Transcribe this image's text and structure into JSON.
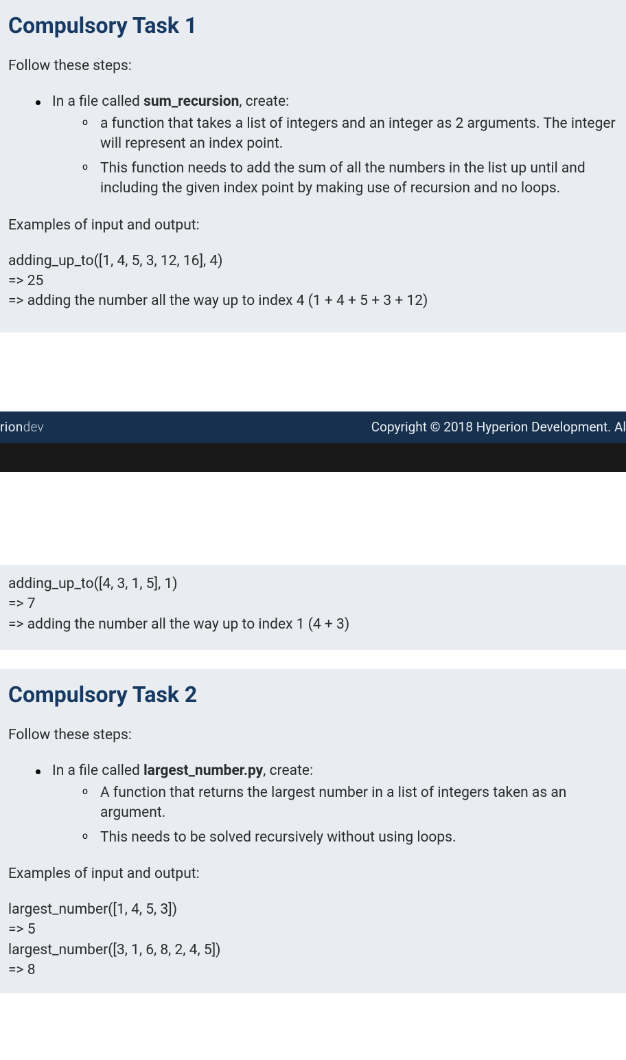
{
  "task1": {
    "title": "Compulsory Task 1",
    "follow": "Follow these steps:",
    "bullet_prefix": "In a file called ",
    "filename": "sum_recursion",
    "bullet_suffix": ", create:",
    "sub1": "a function that takes a list of integers and an integer as 2 arguments. The integer will represent an index point.",
    "sub2": "This function needs to add the sum of all the numbers in the list up until and including the given index point by making use of recursion and no loops.",
    "examples_label": "Examples of input and output:",
    "ex1_line1": "adding_up_to([1, 4, 5, 3, 12, 16], 4)",
    "ex1_line2": "=> 25",
    "ex1_line3": "=> adding the number all the way up to index 4 (1 + 4 + 5 + 3 + 12)",
    "ex2_line1": "adding_up_to([4, 3, 1, 5], 1)",
    "ex2_line2": "=> 7",
    "ex2_line3": "=> adding the number all the way up to index 1 (4 + 3)"
  },
  "footer": {
    "brand_left": "rion",
    "brand_right": "dev",
    "copyright": "Copyright © 2018 Hyperion Development. Al"
  },
  "task2": {
    "title": "Compulsory Task 2",
    "follow": "Follow these steps:",
    "bullet_prefix": "In a file called ",
    "filename": "largest_number.py",
    "bullet_suffix": ", create:",
    "sub1": "A function that returns the largest number in a list of integers taken as an argument.",
    "sub2": "This needs to be solved recursively without using loops.",
    "examples_label": "Examples of input and output:",
    "ex1_line1": "largest_number([1, 4, 5, 3])",
    "ex1_line2": "=> 5",
    "ex2_line1": "largest_number([3, 1, 6, 8, 2, 4, 5])",
    "ex2_line2": "=> 8"
  }
}
